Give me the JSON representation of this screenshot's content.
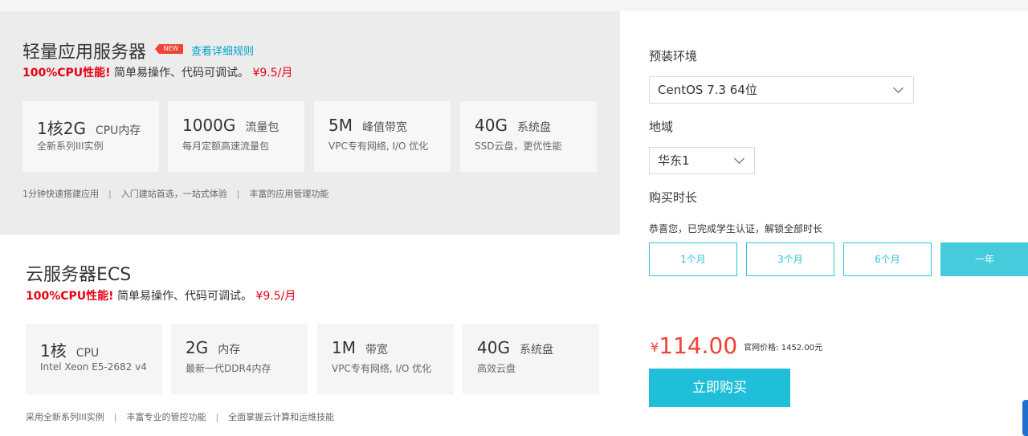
{
  "lightweight": {
    "title": "轻量应用服务器",
    "badge": "NEW",
    "rules_link": "查看详细规则",
    "tag_red": "100%CPU性能!",
    "tag_text": "简单易操作、代码可调试。",
    "tag_price": "¥9.5/月",
    "specs": [
      {
        "main": "1核2G",
        "unit": "CPU内存",
        "sub": "全新系列III实例"
      },
      {
        "main": "1000G",
        "unit": "流量包",
        "sub": "每月定额高速流量包"
      },
      {
        "main": "5M",
        "unit": "峰值带宽",
        "sub": "VPC专有网络, I/O 优化"
      },
      {
        "main": "40G",
        "unit": "系统盘",
        "sub": "SSD云盘，更优性能"
      }
    ],
    "features": [
      "1分钟快速搭建应用",
      "入门建站首选，一站式体验",
      "丰富的应用管理功能"
    ],
    "separator": "|"
  },
  "ecs": {
    "title": "云服务器ECS",
    "tag_red": "100%CPU性能!",
    "tag_text": "简单易操作、代码可调试。",
    "tag_price": "¥9.5/月",
    "specs": [
      {
        "main": "1核",
        "unit": "CPU",
        "sub": "Intel Xeon E5-2682 v4"
      },
      {
        "main": "2G",
        "unit": "内存",
        "sub": "最新一代DDR4内存"
      },
      {
        "main": "1M",
        "unit": "带宽",
        "sub": "VPC专有网络, I/O 优化"
      },
      {
        "main": "40G",
        "unit": "系统盘",
        "sub": "高效云盘"
      }
    ],
    "features": [
      "采用全新系列III实例",
      "丰富专业的管控功能",
      "全面掌握云计算和运维技能"
    ],
    "separator": "|"
  },
  "purchase": {
    "env_label": "预装环境",
    "env_value": "CentOS 7.3 64位",
    "region_label": "地域",
    "region_value": "华东1",
    "duration_label": "购买时长",
    "notice": "恭喜您，已完成学生认证，解锁全部时长",
    "durations": [
      "1个月",
      "3个月",
      "6个月",
      "一年"
    ],
    "selected_duration": "一年",
    "currency": "¥",
    "price": "114.00",
    "official_price": "官网价格: 1452.00元",
    "buy_label": "立即购买"
  },
  "colors": {
    "accent": "#1fbfd9",
    "price_red": "#f04134",
    "tag_red": "#e60012",
    "link_blue": "#00a2ca"
  }
}
